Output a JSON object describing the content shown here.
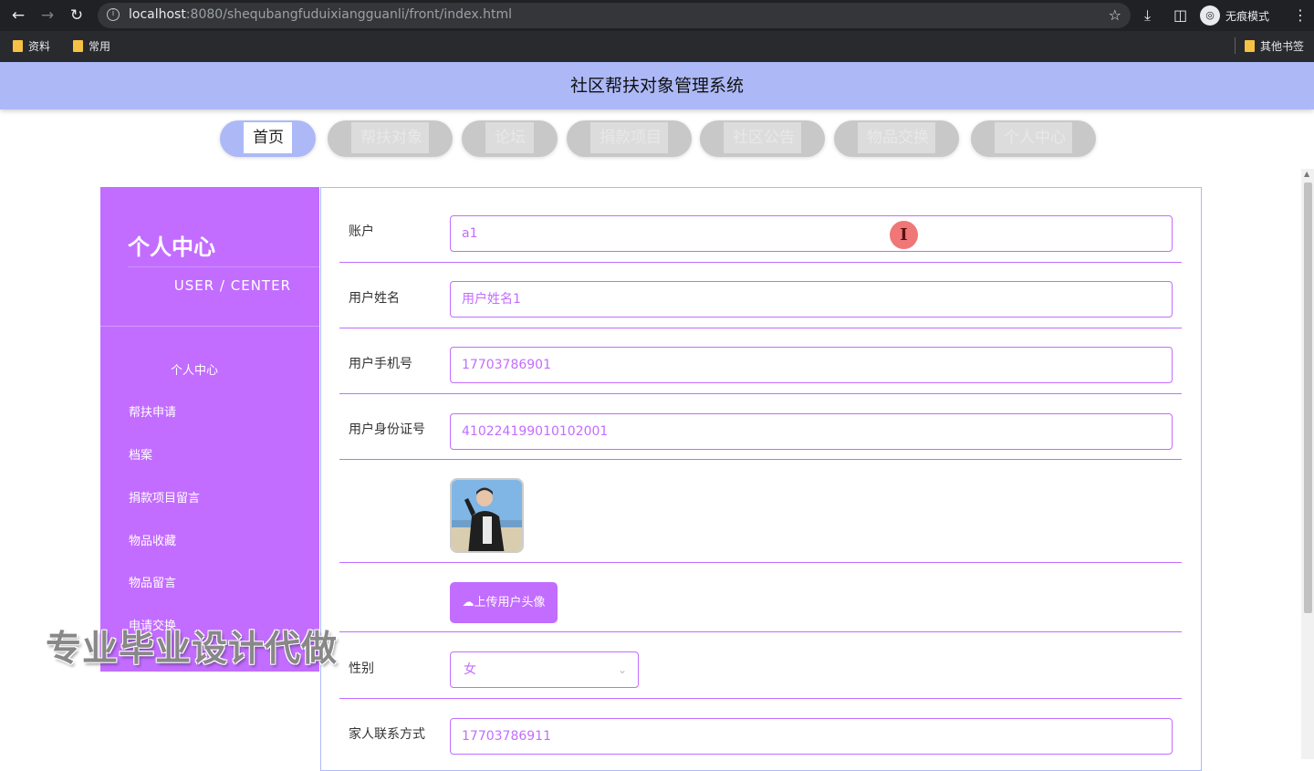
{
  "browser": {
    "url_host": "localhost",
    "url_rest": ":8080/shequbangfuduixiangguanli/front/index.html",
    "incognito_label": "无痕模式",
    "bookmarks": [
      "资料",
      "常用"
    ],
    "other_bookmarks": "其他书签"
  },
  "site": {
    "title": "社区帮扶对象管理系统"
  },
  "nav": {
    "tabs": [
      {
        "label": "首页"
      },
      {
        "label": "帮扶对象"
      },
      {
        "label": "论坛"
      },
      {
        "label": "捐款项目"
      },
      {
        "label": "社区公告"
      },
      {
        "label": "物品交换"
      },
      {
        "label": "个人中心"
      }
    ]
  },
  "sidebar": {
    "title": "个人中心",
    "subtitle": "USER / CENTER",
    "items": [
      {
        "label": "个人中心"
      },
      {
        "label": "帮扶申请"
      },
      {
        "label": "档案"
      },
      {
        "label": "捐款项目留言"
      },
      {
        "label": "物品收藏"
      },
      {
        "label": "物品留言"
      },
      {
        "label": "申请交换"
      }
    ]
  },
  "watermark": "专业毕业设计代做",
  "form": {
    "account_label": "账户",
    "account_value": "a1",
    "name_label": "用户姓名",
    "name_value": "用户姓名1",
    "phone_label": "用户手机号",
    "phone_value": "17703786901",
    "idcard_label": "用户身份证号",
    "idcard_value": "410224199010102001",
    "upload_label": "上传用户头像",
    "gender_label": "性别",
    "gender_value": "女",
    "family_label": "家人联系方式",
    "family_value": "17703786911"
  },
  "colors": {
    "accent": "#c26dff",
    "header": "#adb9f7"
  }
}
